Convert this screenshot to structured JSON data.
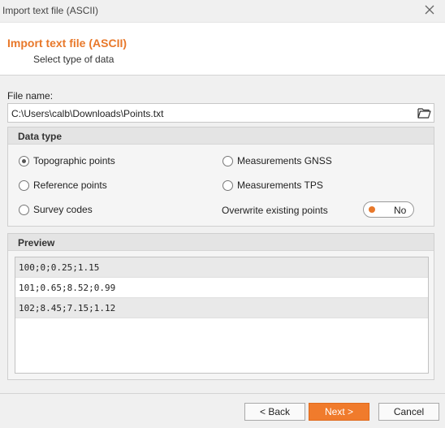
{
  "window": {
    "title": "Import text file (ASCII)",
    "close_icon": "close-icon"
  },
  "header": {
    "title": "Import text file (ASCII)",
    "subtitle": "Select type of data",
    "accent": "#e8782a"
  },
  "file": {
    "label": "File name:",
    "value": "C:\\Users\\calb\\Downloads\\Points.txt",
    "browse_icon": "folder-open-icon"
  },
  "data_type": {
    "heading": "Data type",
    "options": [
      {
        "label": "Topographic points",
        "selected": true
      },
      {
        "label": "Measurements GNSS",
        "selected": false
      },
      {
        "label": "Reference points",
        "selected": false
      },
      {
        "label": "Measurements TPS",
        "selected": false
      },
      {
        "label": "Survey codes",
        "selected": false
      }
    ],
    "overwrite": {
      "label": "Overwrite existing points",
      "value": "No"
    }
  },
  "preview": {
    "heading": "Preview",
    "rows": [
      "100;0;0.25;1.15",
      "101;0.65;8.52;0.99",
      "102;8.45;7.15;1.12"
    ]
  },
  "buttons": {
    "back": "< Back",
    "next": "Next >",
    "cancel": "Cancel"
  }
}
